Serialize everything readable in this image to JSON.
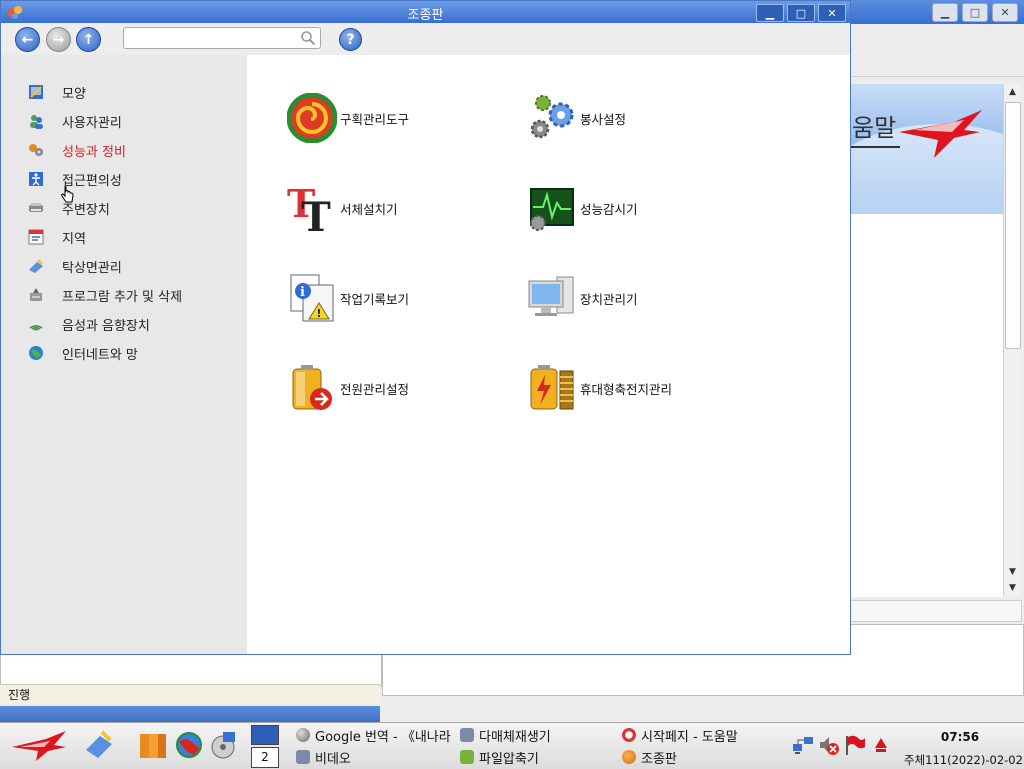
{
  "background_window": {
    "banner_text": "움말",
    "status_text": "진행"
  },
  "window": {
    "title": "조종판",
    "controls": {
      "minimize": "▁",
      "maximize": "□",
      "close": "✕"
    }
  },
  "toolbar": {
    "search_placeholder": "",
    "help_label": "?"
  },
  "sidebar": {
    "items": [
      {
        "label": "모양",
        "icon": "appearance-icon"
      },
      {
        "label": "사용자관리",
        "icon": "users-icon"
      },
      {
        "label": "성능과 정비",
        "icon": "performance-icon",
        "active": true
      },
      {
        "label": "접근편의성",
        "icon": "accessibility-icon"
      },
      {
        "label": "주변장치",
        "icon": "peripherals-icon"
      },
      {
        "label": "지역",
        "icon": "region-icon"
      },
      {
        "label": "탁상면관리",
        "icon": "desktop-icon"
      },
      {
        "label": "프로그람 추가 및 삭제",
        "icon": "programs-icon"
      },
      {
        "label": "음성과 음향장치",
        "icon": "sound-icon"
      },
      {
        "label": "인터네트와 망",
        "icon": "internet-icon"
      }
    ]
  },
  "content": {
    "items": [
      {
        "label": "구획관리도구",
        "icon": "partition-tool-icon"
      },
      {
        "label": "봉사설정",
        "icon": "services-icon"
      },
      {
        "label": "서체설치기",
        "icon": "font-installer-icon"
      },
      {
        "label": "성능감시기",
        "icon": "performance-monitor-icon"
      },
      {
        "label": "작업기록보기",
        "icon": "log-viewer-icon"
      },
      {
        "label": "장치관리기",
        "icon": "device-manager-icon"
      },
      {
        "label": "전원관리설정",
        "icon": "power-settings-icon"
      },
      {
        "label": "휴대형축전지관리",
        "icon": "battery-manager-icon"
      }
    ]
  },
  "taskbar": {
    "pager_number": "2",
    "tasks": [
      {
        "label": "Google 번역 - 《내나라",
        "icon": "browser-icon"
      },
      {
        "label": "다매체재생기",
        "icon": "media-player-icon"
      },
      {
        "label": "시작페지 - 도움말",
        "icon": "help-icon"
      },
      {
        "label": "비데오",
        "icon": "video-icon"
      },
      {
        "label": "파일압축기",
        "icon": "archive-icon"
      },
      {
        "label": "조종판",
        "icon": "control-panel-icon"
      }
    ],
    "clock": "07:56",
    "date": "주체111(2022)-02-02"
  },
  "colors": {
    "title_bar": "#3b6fd0",
    "active_link": "#d81e2c",
    "sidebar_bg": "#e8e8e8"
  }
}
